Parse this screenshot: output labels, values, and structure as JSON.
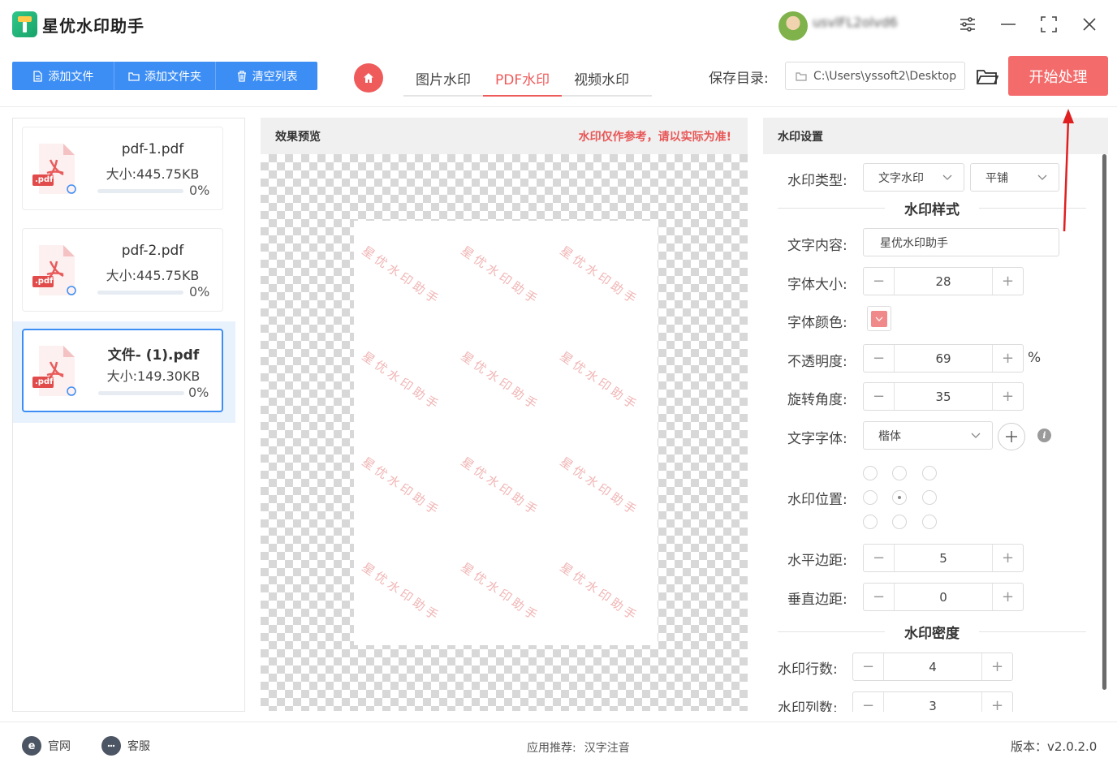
{
  "app": {
    "title": "星优水印助手",
    "user_name": "usvlFL2olvd6"
  },
  "toolbar": {
    "add_file": "添加文件",
    "add_folder": "添加文件夹",
    "clear_list": "清空列表"
  },
  "tabs": [
    {
      "label": "图片水印",
      "active": false
    },
    {
      "label": "PDF水印",
      "active": true
    },
    {
      "label": "视频水印",
      "active": false
    }
  ],
  "save": {
    "label": "保存目录:",
    "path": "C:\\Users\\yssoft2\\Desktop"
  },
  "start_button": "开始处理",
  "files": [
    {
      "name": "pdf-1.pdf",
      "size": "大小:445.75KB",
      "progress": "0%",
      "progress_value": 0,
      "selected": false
    },
    {
      "name": "pdf-2.pdf",
      "size": "大小:445.75KB",
      "progress": "0%",
      "progress_value": 0,
      "selected": false
    },
    {
      "name": "文件- (1).pdf",
      "size": "大小:149.30KB",
      "progress": "0%",
      "progress_value": 0,
      "selected": true
    }
  ],
  "pdf_badge": ".pdf",
  "preview": {
    "title": "效果预览",
    "note": "水印仅作参考，请以实际为准!",
    "watermark_text": "星优水印助手"
  },
  "settings": {
    "title": "水印设置",
    "type_label": "水印类型:",
    "type_value": "文字水印",
    "layout_value": "平铺",
    "style_section": "水印样式",
    "content_label": "文字内容:",
    "content_value": "星优水印助手",
    "font_size_label": "字体大小:",
    "font_size_value": "28",
    "font_color_label": "字体颜色:",
    "font_color_hex": "#f08a8a",
    "opacity_label": "不透明度:",
    "opacity_value": "69",
    "opacity_unit": "%",
    "rotation_label": "旋转角度:",
    "rotation_value": "35",
    "font_family_label": "文字字体:",
    "font_family_value": "楷体",
    "position_label": "水印位置:",
    "position_selected": "center",
    "h_margin_label": "水平边距:",
    "h_margin_value": "5",
    "v_margin_label": "垂直边距:",
    "v_margin_value": "0",
    "density_section": "水印密度",
    "rows_label": "水印行数:",
    "rows_value": "4",
    "cols_label": "水印列数:",
    "cols_value": "3"
  },
  "footer": {
    "website": "官网",
    "support": "客服",
    "recommend_label": "应用推荐:",
    "recommend_app": "汉字注音",
    "version": "版本：v2.0.2.0"
  },
  "colors": {
    "accent_blue": "#3c8ef5",
    "accent_red": "#f46b6b"
  }
}
